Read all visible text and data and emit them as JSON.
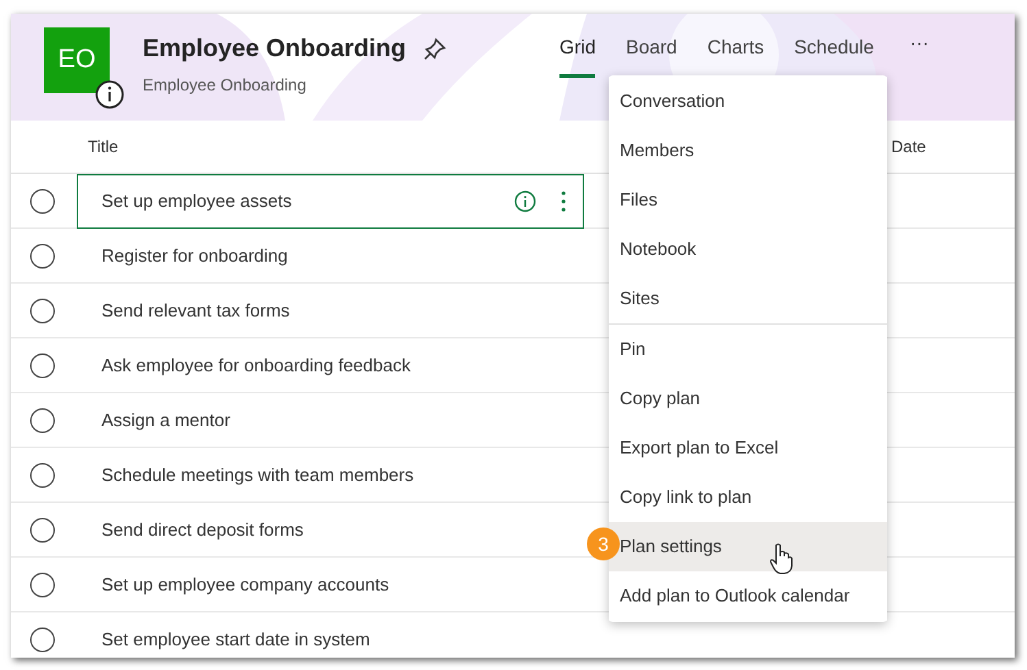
{
  "plan": {
    "initials": "EO",
    "title": "Employee Onboarding",
    "subtitle": "Employee Onboarding"
  },
  "tabs": [
    {
      "label": "Grid",
      "selected": true
    },
    {
      "label": "Board",
      "selected": false
    },
    {
      "label": "Charts",
      "selected": false
    },
    {
      "label": "Schedule",
      "selected": false
    }
  ],
  "more_button": "···",
  "table": {
    "columns": [
      "Title",
      "Date"
    ],
    "rows": [
      {
        "title": "Set up employee assets",
        "selected": true,
        "checked": false
      },
      {
        "title": "Register for onboarding",
        "selected": false,
        "checked": false
      },
      {
        "title": "Send relevant tax forms",
        "selected": false,
        "checked": false
      },
      {
        "title": "Ask employee for onboarding feedback",
        "selected": false,
        "checked": false
      },
      {
        "title": "Assign a mentor",
        "selected": false,
        "checked": false
      },
      {
        "title": "Schedule meetings with team members",
        "selected": false,
        "checked": false
      },
      {
        "title": "Send direct deposit forms",
        "selected": false,
        "checked": false
      },
      {
        "title": "Set up employee company accounts",
        "selected": false,
        "checked": false
      },
      {
        "title": "Set employee start date in system",
        "selected": false,
        "checked": false
      }
    ]
  },
  "menu": {
    "groups": [
      [
        {
          "label": "Conversation",
          "selected": false
        },
        {
          "label": "Members",
          "selected": false
        },
        {
          "label": "Files",
          "selected": false
        },
        {
          "label": "Notebook",
          "selected": false
        },
        {
          "label": "Sites",
          "selected": false
        }
      ],
      [
        {
          "label": "Pin",
          "selected": false
        },
        {
          "label": "Copy plan",
          "selected": false
        },
        {
          "label": "Export plan to Excel",
          "selected": false
        },
        {
          "label": "Copy link to plan",
          "selected": false
        },
        {
          "label": "Plan settings",
          "selected": true
        },
        {
          "label": "Add plan to Outlook calendar",
          "selected": false
        }
      ]
    ]
  },
  "step_badge": "3"
}
